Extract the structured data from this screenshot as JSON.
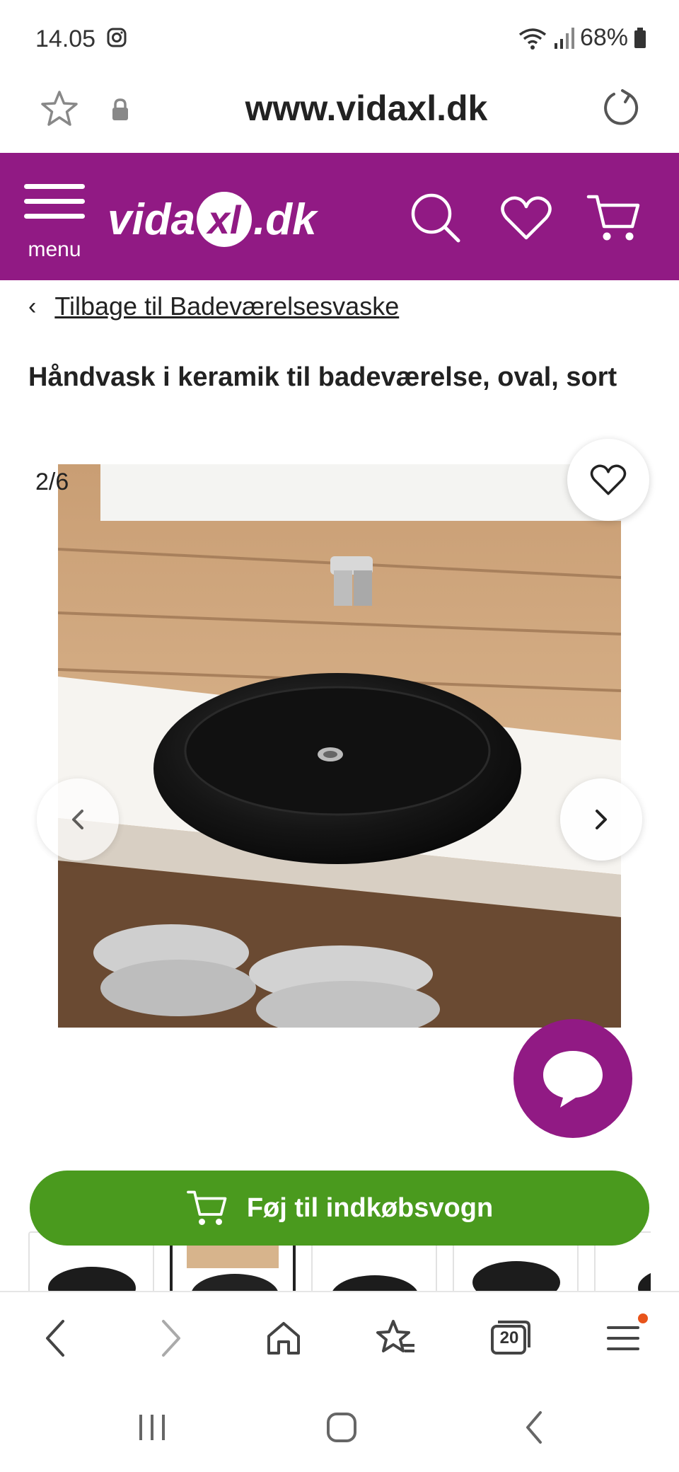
{
  "status_bar": {
    "time": "14.05",
    "battery": "68%"
  },
  "address_bar": {
    "url": "www.vidaxl.dk"
  },
  "site_header": {
    "logo_text_left": "vida",
    "logo_text_xl": "xl",
    "logo_text_right": ".dk",
    "menu_label": "menu",
    "brand_color": "#911a84"
  },
  "breadcrumb": {
    "back_label": "Tilbage til Badeværelsesvaske"
  },
  "product": {
    "title": "Håndvask i keramik til badeværelse, oval, sort",
    "image_counter": "2/6"
  },
  "actions": {
    "add_to_cart_label": "Føj til indkøbsvogn",
    "add_to_cart_color": "#4a9a1e"
  },
  "browser_bar": {
    "tabs_count": "20"
  },
  "icons": [
    "instagram-icon",
    "wifi-icon",
    "signal-icon",
    "battery-icon",
    "star-icon",
    "lock-icon",
    "reload-icon",
    "menu-icon",
    "search-icon",
    "heart-icon",
    "cart-icon",
    "chevron-left-icon",
    "chevron-right-icon",
    "chat-icon",
    "home-icon",
    "bookmarks-icon",
    "tabs-icon",
    "hamburger-icon",
    "recents-icon",
    "home-circle-icon",
    "back-icon"
  ]
}
